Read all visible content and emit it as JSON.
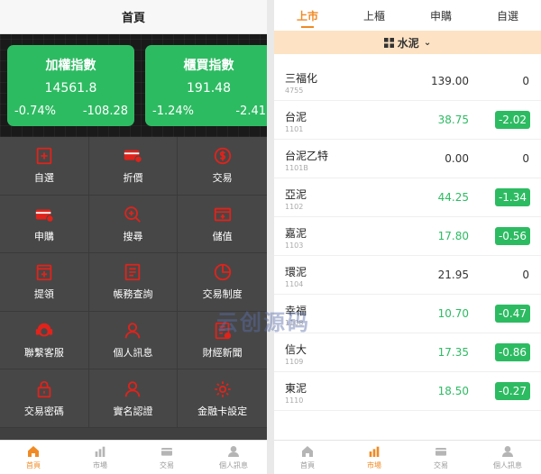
{
  "colors": {
    "accent": "#f08a24",
    "up_green": "#2dbb62",
    "menu_red": "#e0231b",
    "filter_bg": "#fde2c3"
  },
  "left": {
    "title": "首頁",
    "cards": [
      {
        "name": "加權指數",
        "value": "14561.8",
        "percent": "-0.74%",
        "change": "-108.28"
      },
      {
        "name": "櫃買指數",
        "value": "191.48",
        "percent": "-1.24%",
        "change": "-2.41"
      }
    ],
    "menu": [
      {
        "label": "自選",
        "icon": "star-add-icon"
      },
      {
        "label": "折價",
        "icon": "discount-card-icon"
      },
      {
        "label": "交易",
        "icon": "dollar-circle-icon"
      },
      {
        "label": "申購",
        "icon": "subscribe-card-icon"
      },
      {
        "label": "搜尋",
        "icon": "search-plus-icon"
      },
      {
        "label": "儲值",
        "icon": "deposit-card-icon"
      },
      {
        "label": "提領",
        "icon": "withdraw-icon"
      },
      {
        "label": "帳務查詢",
        "icon": "ledger-icon"
      },
      {
        "label": "交易制度",
        "icon": "pie-clock-icon"
      },
      {
        "label": "聯繫客服",
        "icon": "headset-icon"
      },
      {
        "label": "個人訊息",
        "icon": "user-icon"
      },
      {
        "label": "財經新聞",
        "icon": "news-icon"
      },
      {
        "label": "交易密碼",
        "icon": "lock-icon"
      },
      {
        "label": "實名認證",
        "icon": "user-verify-icon"
      },
      {
        "label": "金融卡設定",
        "icon": "gear-icon"
      }
    ],
    "tabbar": [
      {
        "label": "首頁",
        "icon": "home-icon",
        "active": true
      },
      {
        "label": "市場",
        "icon": "market-chart-icon",
        "active": false
      },
      {
        "label": "交易",
        "icon": "trade-icon",
        "active": false
      },
      {
        "label": "個人訊息",
        "icon": "profile-icon",
        "active": false
      }
    ]
  },
  "right": {
    "tabs": [
      {
        "label": "上市",
        "active": true
      },
      {
        "label": "上櫃",
        "active": false
      },
      {
        "label": "申購",
        "active": false
      },
      {
        "label": "自選",
        "active": false
      }
    ],
    "filter": {
      "label": "水泥",
      "icon": "grid-icon"
    },
    "rows": [
      {
        "name": "三福化",
        "code": "4755",
        "price": "139.00",
        "change": "0",
        "up": false
      },
      {
        "name": "台泥",
        "code": "1101",
        "price": "38.75",
        "change": "-2.02",
        "up": true
      },
      {
        "name": "台泥乙特",
        "code": "1101B",
        "price": "0.00",
        "change": "0",
        "up": false
      },
      {
        "name": "亞泥",
        "code": "1102",
        "price": "44.25",
        "change": "-1.34",
        "up": true
      },
      {
        "name": "嘉泥",
        "code": "1103",
        "price": "17.80",
        "change": "-0.56",
        "up": true
      },
      {
        "name": "環泥",
        "code": "1104",
        "price": "21.95",
        "change": "0",
        "up": false
      },
      {
        "name": "幸福",
        "code": "1108",
        "price": "10.70",
        "change": "-0.47",
        "up": true
      },
      {
        "name": "信大",
        "code": "1109",
        "price": "17.35",
        "change": "-0.86",
        "up": true
      },
      {
        "name": "東泥",
        "code": "1110",
        "price": "18.50",
        "change": "-0.27",
        "up": true
      }
    ],
    "tabbar": [
      {
        "label": "首頁",
        "icon": "home-icon",
        "active": false
      },
      {
        "label": "市場",
        "icon": "market-chart-icon",
        "active": true
      },
      {
        "label": "交易",
        "icon": "trade-icon",
        "active": false
      },
      {
        "label": "個人訊息",
        "icon": "profile-icon",
        "active": false
      }
    ]
  },
  "watermark": "云创源码"
}
